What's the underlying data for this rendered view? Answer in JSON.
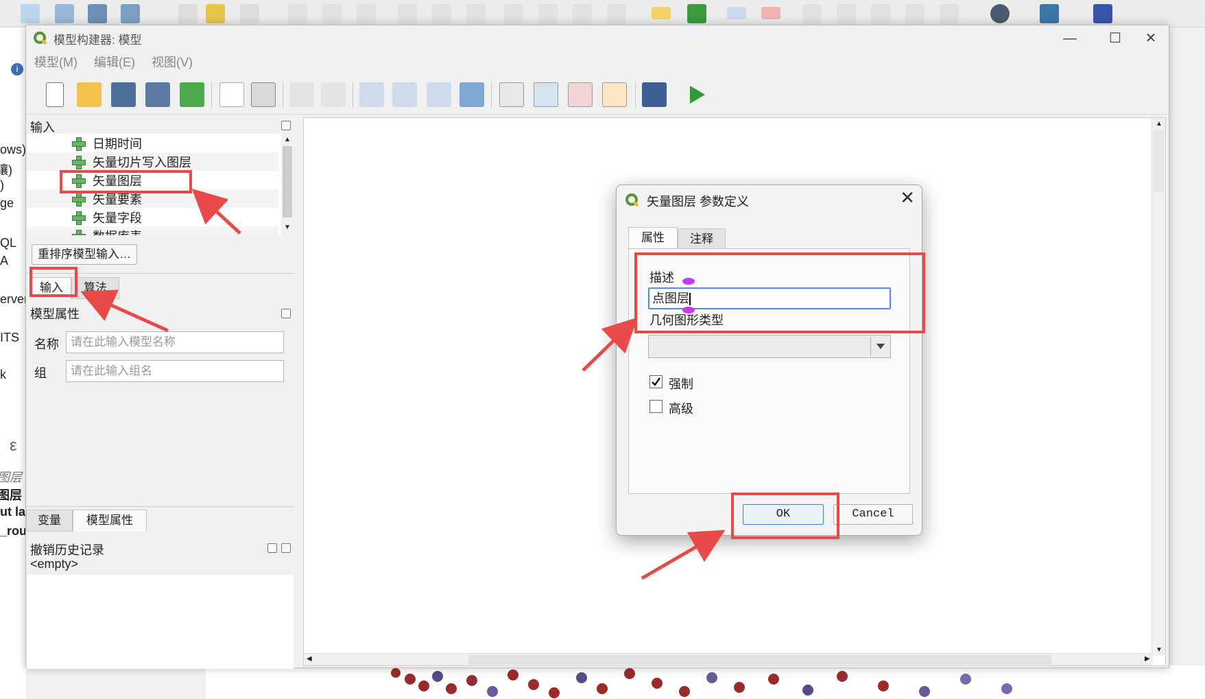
{
  "window": {
    "title": "模型构建器: 模型",
    "menus": [
      "模型(M)",
      "编辑(E)",
      "视图(V)"
    ]
  },
  "background": {
    "side_texts": [
      "ows)",
      "禳)",
      ")",
      "ge",
      "QL",
      "A",
      "erver",
      "ITS",
      "k",
      "ε",
      "图层",
      "图层",
      "ut la",
      "_rou"
    ]
  },
  "inputs_panel": {
    "title": "输入",
    "items": [
      "日期时间",
      "矢量切片写入图层",
      "矢量图层",
      "矢量要素",
      "矢量字段",
      "数据库表"
    ],
    "reorder_button": "重排序模型输入…",
    "tabs": [
      "输入",
      "算法"
    ]
  },
  "model_properties": {
    "title": "模型属性",
    "name_label": "名称",
    "name_placeholder": "请在此输入模型名称",
    "group_label": "组",
    "group_placeholder": "请在此输入组名"
  },
  "bottom_tabs": [
    "变量",
    "模型属性"
  ],
  "undo_panel": {
    "title": "撤销历史记录",
    "empty_text": "<empty>"
  },
  "dialog": {
    "title": "矢量图层 参数定义",
    "close": "✕",
    "tabs": [
      "属性",
      "注释"
    ],
    "description_label": "描述",
    "description_value": "点图层",
    "geometry_label": "几何图形类型",
    "mandatory_label": "强制",
    "mandatory_checked": true,
    "advanced_label": "高级",
    "advanced_checked": false,
    "ok_button": "OK",
    "cancel_button": "Cancel"
  },
  "colors": {
    "annotation_red": "#e84a4a",
    "input_focus": "#4a8fe3",
    "qgis_green": "#589632"
  }
}
